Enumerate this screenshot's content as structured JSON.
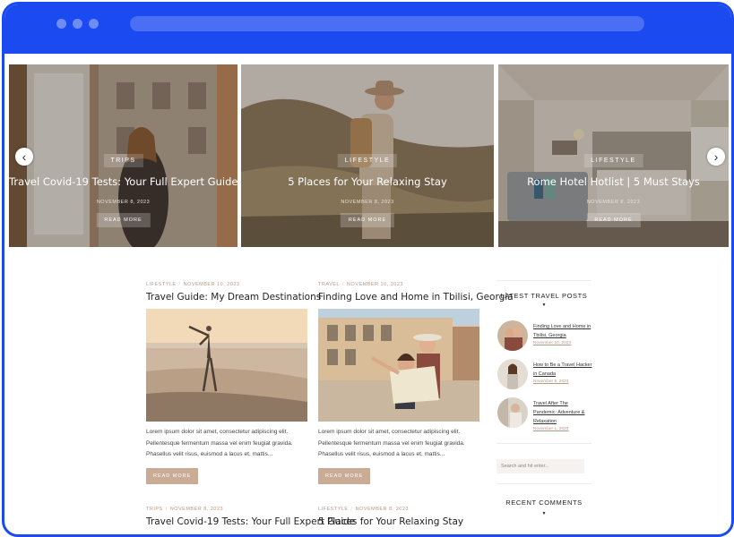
{
  "slider": {
    "slides": [
      {
        "category": "Trips",
        "title": "Travel Covid-19 Tests: Your Full Expert Guide",
        "date": "November 8, 2023",
        "button": "Read More"
      },
      {
        "category": "Lifestyle",
        "title": "5 Places for Your Relaxing Stay",
        "date": "November 8, 2023",
        "button": "Read More"
      },
      {
        "category": "Lifestyle",
        "title": "Rome Hotel Hotlist | 5 Must Stays",
        "date": "November 8, 2023",
        "button": "Read More"
      }
    ],
    "prev_icon": "‹",
    "next_icon": "›"
  },
  "posts": [
    {
      "category": "Lifestyle",
      "date": "November 10, 2023",
      "title": "Travel Guide: My Dream Destinations",
      "excerpt": "Lorem ipsum dolor sit amet, consectetur adipiscing elit. Pellentesque fermentum massa vel enim feugiat gravida. Phasellus velit risus, euismod a lacus et, mattis...",
      "button": "Read More"
    },
    {
      "category": "Travel",
      "date": "November 10, 2023",
      "title": "Finding Love and Home in Tbilisi, Georgia",
      "excerpt": "Lorem ipsum dolor sit amet, consectetur adipiscing elit. Pellentesque fermentum massa vel enim feugiat gravida. Phasellus velit risus, euismod a lacus et, mattis...",
      "button": "Read More"
    },
    {
      "category": "Trips",
      "date": "November 8, 2023",
      "title": "Travel Covid-19 Tests: Your Full Expert Guide"
    },
    {
      "category": "Lifestyle",
      "date": "November 8, 2023",
      "title": "5 Places for Your Relaxing Stay"
    }
  ],
  "sidebar": {
    "latest_heading": "Latest Travel Posts",
    "latest": [
      {
        "title": "Finding Love and Home in Tbilisi, Georgia",
        "date": "November 10, 2023"
      },
      {
        "title": "How to Be a Travel Hacker in Canada",
        "date": "November 8, 2023"
      },
      {
        "title": "Travel After The Pandemic: Adventure & Relaxation",
        "date": "November 1, 2023"
      }
    ],
    "search_placeholder": "Search and hit enter...",
    "comments_heading": "Recent Comments",
    "caret": "▼"
  },
  "colors": {
    "frame": "#1b4bf0",
    "accent": "#c9ab96"
  }
}
